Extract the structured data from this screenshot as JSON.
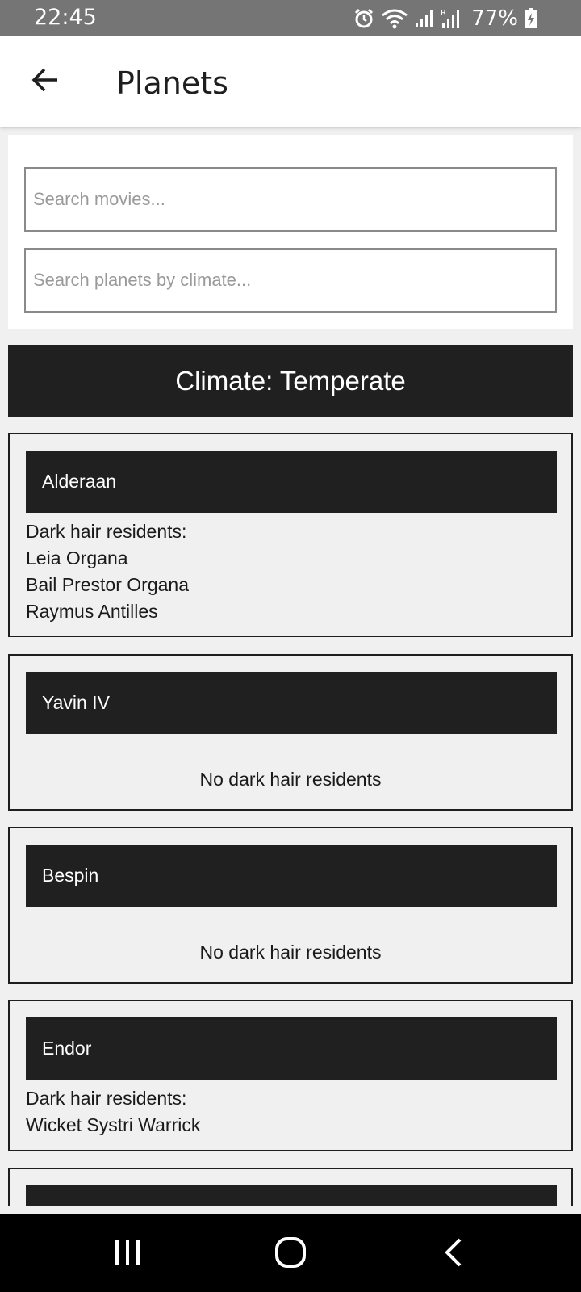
{
  "status_bar": {
    "time": "22:45",
    "battery": "77%",
    "icons": [
      "alarm-icon",
      "wifi-icon",
      "signal-icon",
      "signal-roaming-icon",
      "battery-charging-icon"
    ]
  },
  "app_bar": {
    "title": "Planets",
    "back_icon": "arrow-left-icon"
  },
  "search": {
    "movies_placeholder": "Search movies...",
    "movies_value": "",
    "climate_placeholder": "Search planets by climate...",
    "climate_value": ""
  },
  "climate_header": "Climate: Temperate",
  "planets": [
    {
      "name": "Alderaan",
      "residents_label": "Dark hair residents:",
      "residents": [
        "Leia Organa",
        "Bail Prestor Organa",
        "Raymus Antilles"
      ]
    },
    {
      "name": "Yavin IV",
      "empty_text": "No dark hair residents"
    },
    {
      "name": "Bespin",
      "empty_text": "No dark hair residents"
    },
    {
      "name": "Endor",
      "residents_label": "Dark hair residents:",
      "residents": [
        "Wicket Systri Warrick"
      ]
    }
  ],
  "nav_bar": {
    "icons": [
      "recent-apps-icon",
      "home-icon",
      "back-icon"
    ]
  },
  "colors": {
    "status_bar": "#757575",
    "header_dark": "#202020",
    "background": "#f0f0f0"
  }
}
